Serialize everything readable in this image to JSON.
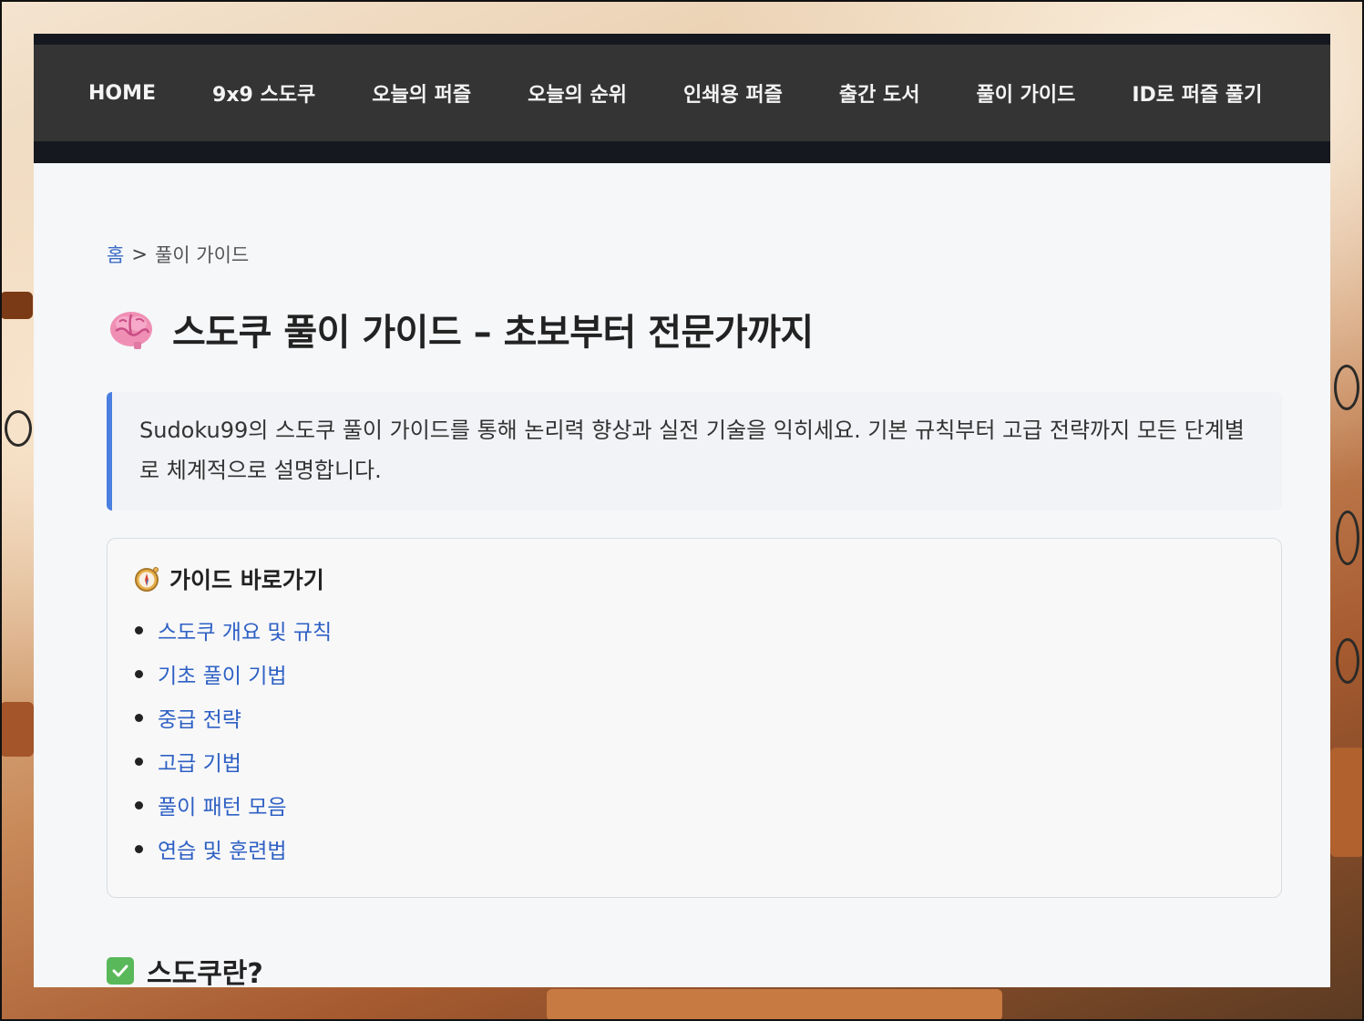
{
  "nav": {
    "items": [
      {
        "label": "HOME"
      },
      {
        "label": "9x9 스도쿠"
      },
      {
        "label": "오늘의 퍼즐"
      },
      {
        "label": "오늘의 순위"
      },
      {
        "label": "인쇄용 퍼즐"
      },
      {
        "label": "출간 도서"
      },
      {
        "label": "풀이 가이드"
      },
      {
        "label": "ID로 퍼즐 풀기"
      }
    ]
  },
  "breadcrumb": {
    "home": "홈",
    "separator": ">",
    "current": "풀이 가이드"
  },
  "page": {
    "title_icon": "brain-icon",
    "title": "스도쿠 풀이 가이드 – 초보부터 전문가까지",
    "intro": "Sudoku99의 스도쿠 풀이 가이드를 통해 논리력 향상과 실전 기술을 익히세요. 기본 규칙부터 고급 전략까지 모든 단계별로 체계적으로 설명합니다."
  },
  "toc": {
    "icon": "compass-icon",
    "heading": "가이드 바로가기",
    "items": [
      {
        "label": "스도쿠 개요 및 규칙"
      },
      {
        "label": "기초 풀이 기법"
      },
      {
        "label": "중급 전략"
      },
      {
        "label": "고급 기법"
      },
      {
        "label": "풀이 패턴 모음"
      },
      {
        "label": "연습 및 훈련법"
      }
    ]
  },
  "section": {
    "icon": "check-icon",
    "heading": "스도쿠란?"
  },
  "colors": {
    "nav_bg": "#343434",
    "topbar_bg": "#15181f",
    "link": "#2e60c4",
    "intro_border": "#4a7ee0",
    "page_bg": "#f6f7f9"
  }
}
